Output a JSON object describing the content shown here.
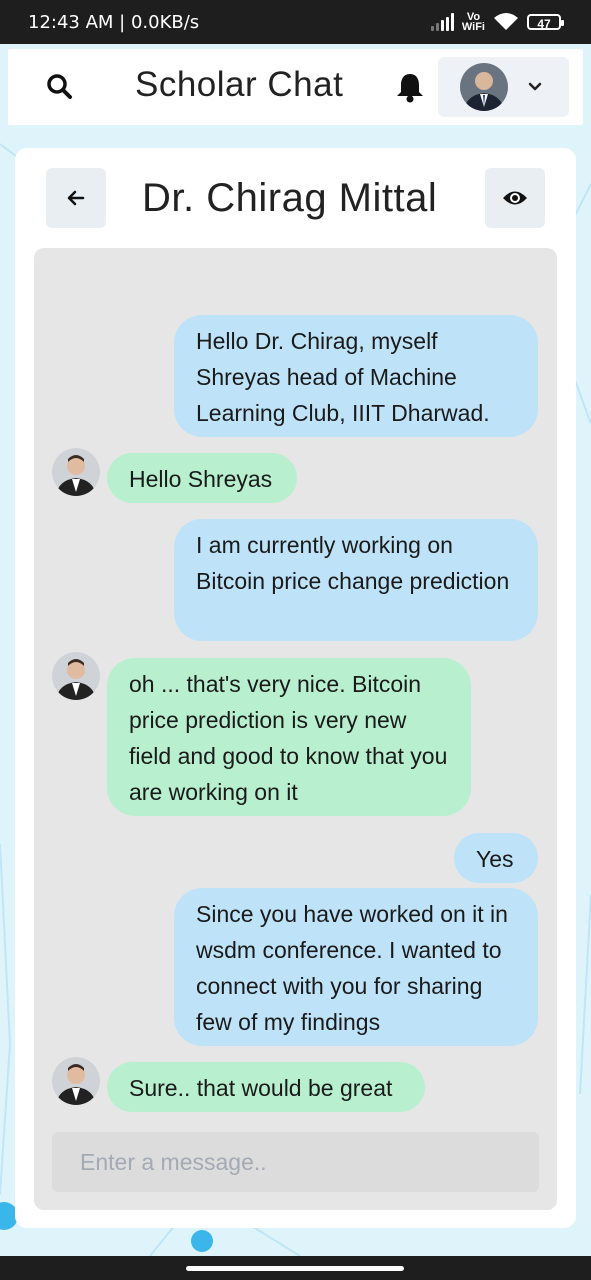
{
  "status_bar": {
    "time": "12:43 AM | 0.0KB/s",
    "vowifi_top": "Vo",
    "vowifi_bottom": "WiFi",
    "battery": "47"
  },
  "header": {
    "app_title": "Scholar Chat",
    "search_icon": "search-icon",
    "bell_icon": "bell-icon",
    "profile_chevron_icon": "chevron-down-icon"
  },
  "chat": {
    "contact_name": "Dr. Chirag Mittal",
    "back_icon": "arrow-left-icon",
    "view_icon": "eye-icon",
    "messages": [
      {
        "from": "me",
        "text": "Hello Dr. Chirag, myself Shreyas head of Machine Learning Club, IIIT Dharwad."
      },
      {
        "from": "peer",
        "text": "Hello Shreyas"
      },
      {
        "from": "me",
        "text": "I am currently working on Bitcoin price change prediction"
      },
      {
        "from": "peer",
        "text": "oh ... that's very nice. Bitcoin price prediction is very new field and good to know that you are working on it"
      },
      {
        "from": "me",
        "text": "Yes"
      },
      {
        "from": "me",
        "text": "Since you have worked on it in wsdm conference. I wanted to connect with you for sharing few of my findings"
      },
      {
        "from": "peer",
        "text": "Sure.. that would be great"
      }
    ],
    "input_placeholder": "Enter a message.."
  },
  "colors": {
    "outgoing_bubble": "#bee3f8",
    "incoming_bubble": "#b8f0cf",
    "chat_background": "#e6e6e6",
    "page_background": "#dff3fb"
  }
}
